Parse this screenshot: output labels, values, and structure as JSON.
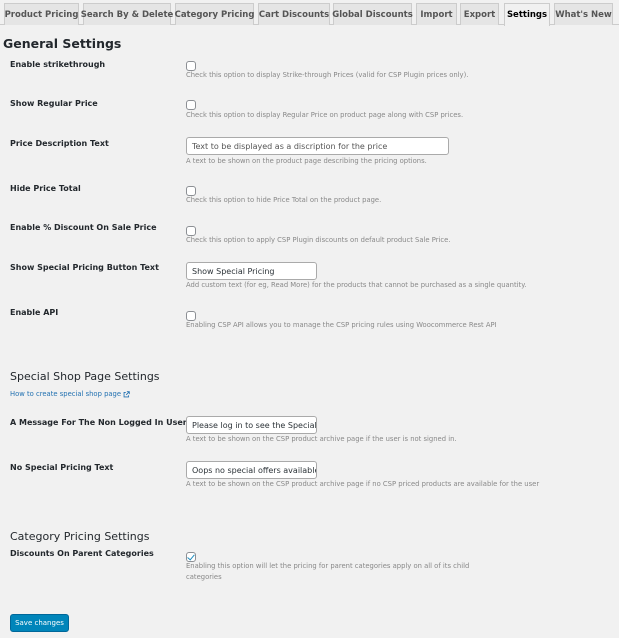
{
  "tabs": [
    {
      "label": "Product Pricing",
      "active": false
    },
    {
      "label": "Search By & Delete",
      "active": false
    },
    {
      "label": "Category Pricing",
      "active": false
    },
    {
      "label": "Cart Discounts",
      "active": false
    },
    {
      "label": "Global Discounts",
      "active": false
    },
    {
      "label": "Import",
      "active": false
    },
    {
      "label": "Export",
      "active": false
    },
    {
      "label": "Settings",
      "active": true
    },
    {
      "label": "What's New",
      "active": false
    }
  ],
  "general": {
    "title": "General Settings",
    "strikethrough": {
      "label": "Enable strikethrough",
      "checked": false,
      "desc": "Check this option to display Strike-through Prices (valid for CSP Plugin prices only)."
    },
    "regular_price": {
      "label": "Show Regular Price",
      "checked": false,
      "desc": "Check this option to display Regular Price on product page along with CSP prices."
    },
    "price_desc": {
      "label": "Price Description Text",
      "value": "",
      "placeholder": "Text to be displayed as a discription for the price",
      "desc": "A text to be shown on the product page describing the pricing options."
    },
    "hide_total": {
      "label": "Hide Price Total",
      "checked": false,
      "desc": "Check this option to hide Price Total on the product page."
    },
    "discount_sale": {
      "label": "Enable % Discount On Sale Price",
      "checked": false,
      "desc": "Check this option to apply CSP Plugin discounts on default product Sale Price."
    },
    "special_btn": {
      "label": "Show Special Pricing Button Text",
      "value": "Show Special Pricing",
      "desc": "Add custom text (for eg, Read More) for the products that cannot be purchased as a single quantity."
    },
    "api": {
      "label": "Enable API",
      "checked": false,
      "desc": "Enabling CSP API allows you to manage the CSP pricing rules using Woocommerce Rest API"
    }
  },
  "shop": {
    "title": "Special Shop Page Settings",
    "link": "How to create special shop page",
    "non_logged": {
      "label": "A Message For The Non Logged In User",
      "value": "Please log in to see the Special Offers",
      "desc": "A text to be shown on the CSP product archive page if the user is not signed in."
    },
    "no_special": {
      "label": "No Special Pricing Text",
      "value": "Oops no special offers available",
      "desc": "A text to be shown on the CSP product archive page if no CSP priced products are available for the user"
    }
  },
  "category": {
    "title": "Category Pricing Settings",
    "parent": {
      "label": "Discounts On Parent Categories",
      "checked": true,
      "desc_line1": "Enabling this option will let the pricing for parent categories apply on all of its child",
      "desc_line2": "categories"
    }
  },
  "save_label": "Save changes"
}
